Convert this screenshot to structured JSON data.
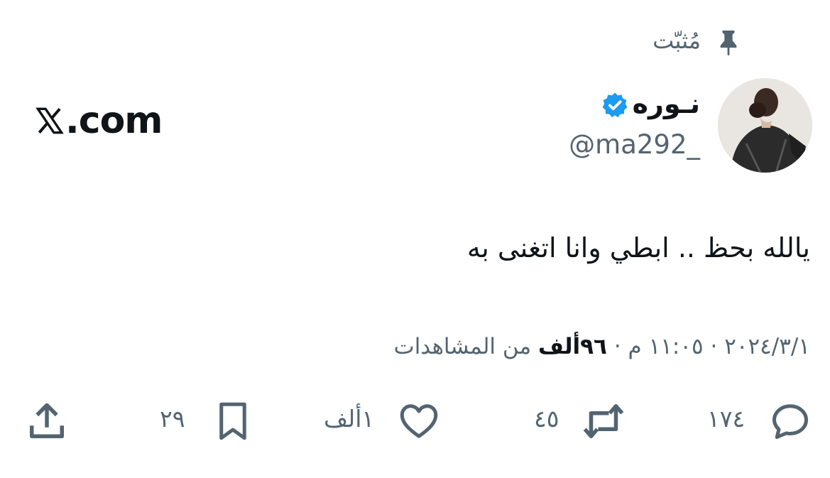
{
  "pinned": {
    "label": "مُثبّت",
    "icon": "pin-icon"
  },
  "author": {
    "display_name": "نـوره",
    "handle": "@ma292_",
    "verified_icon": "verified-badge-icon",
    "verified_color": "#1d9bf0",
    "avatar": "avatar"
  },
  "brand": {
    "logo": "x-logo-icon",
    "text": ".com"
  },
  "tweet": {
    "text": "يالله بحظ .. ابطي وانا اتغنى به",
    "date": "٢٠٢٤/٣/١",
    "time": "١١:٠٥ م",
    "separator": " · ",
    "views_count": "٩٦ألف",
    "views_label": "من المشاهدات"
  },
  "actions": {
    "replies": {
      "icon": "reply-icon",
      "count": "١٧٤"
    },
    "reposts": {
      "icon": "repost-icon",
      "count": "٤٥"
    },
    "likes": {
      "icon": "heart-icon",
      "count": "١ألف"
    },
    "bookmarks": {
      "icon": "bookmark-icon",
      "count": "٢٩"
    },
    "share": {
      "icon": "share-icon"
    }
  },
  "colors": {
    "text": "#0f1419",
    "secondary": "#536471",
    "background": "#ffffff"
  }
}
